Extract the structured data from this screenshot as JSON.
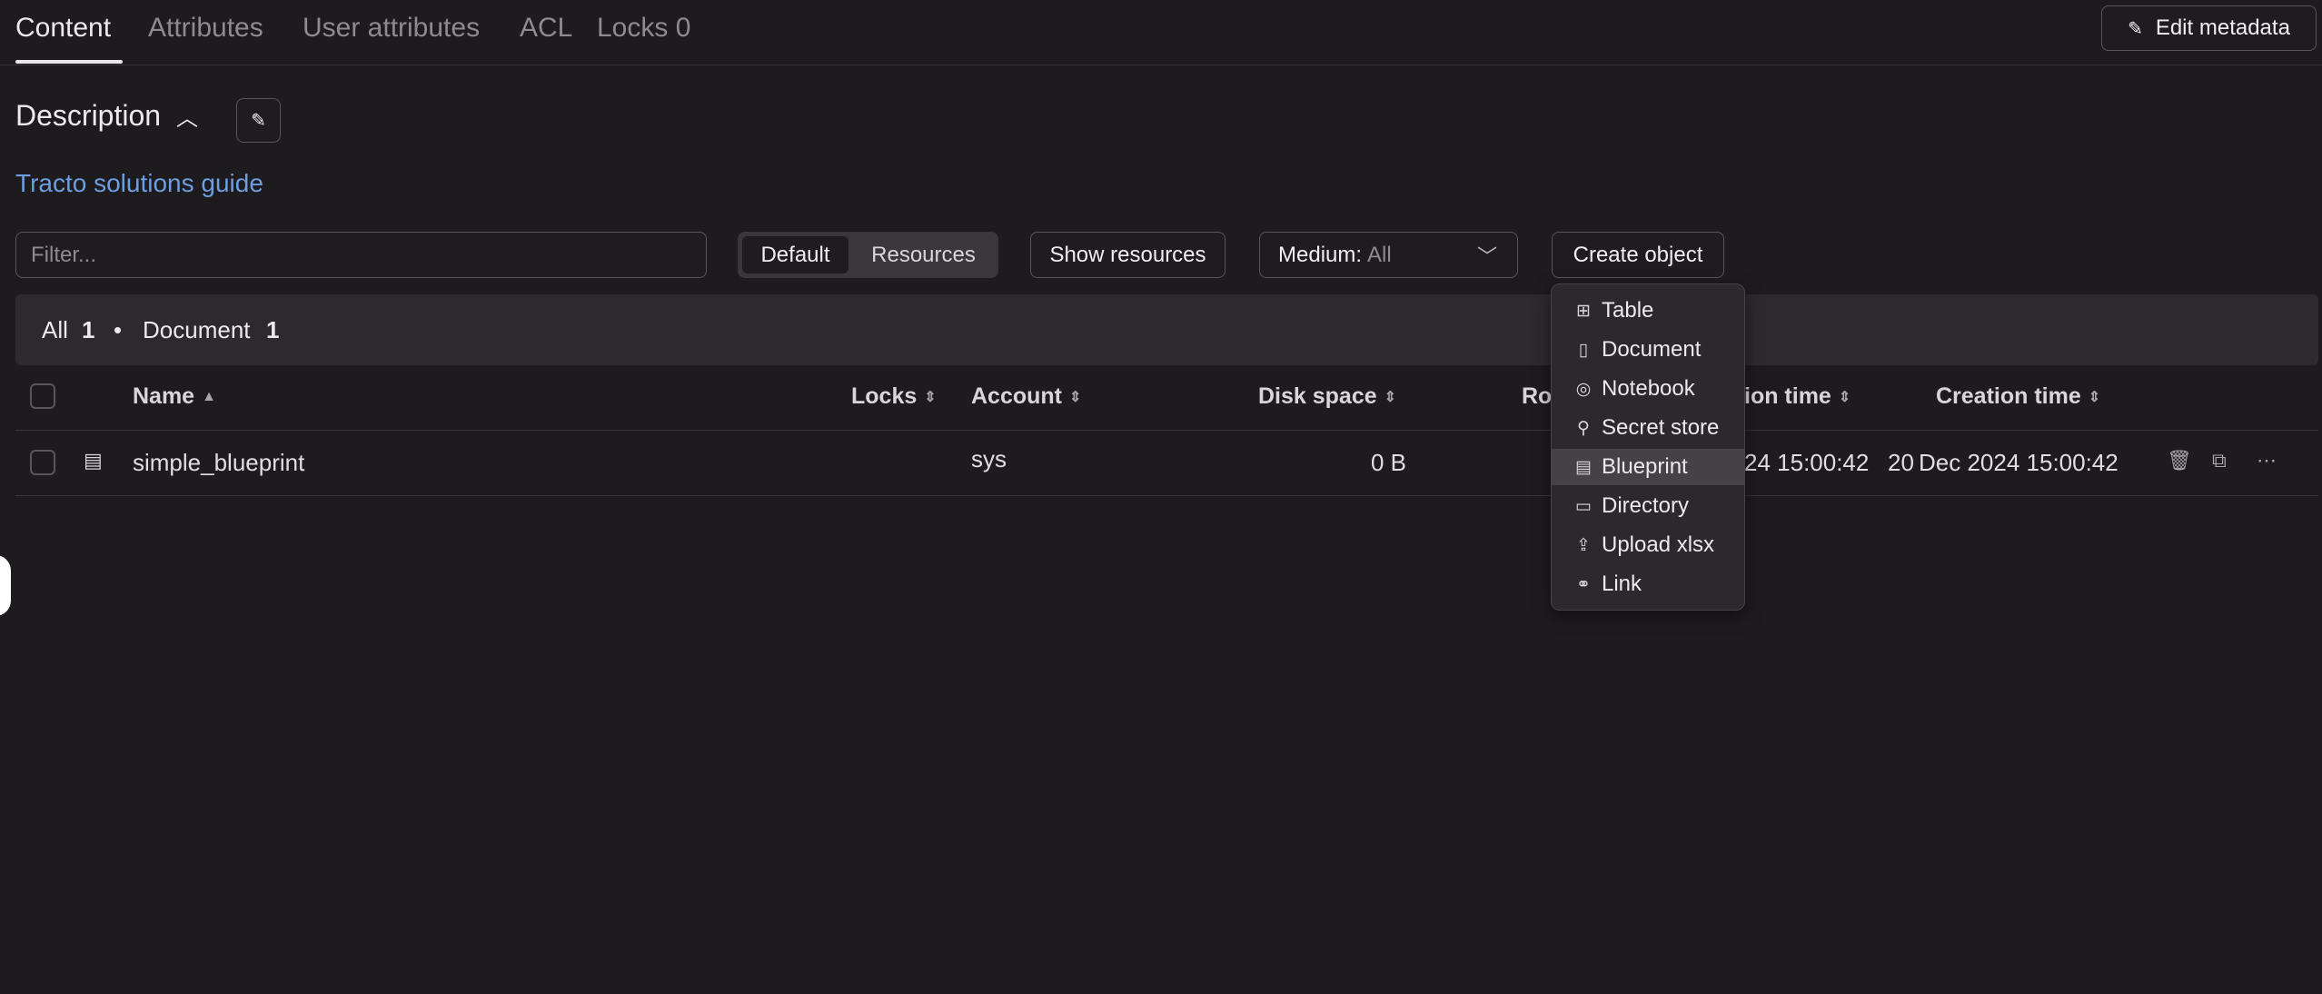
{
  "tabs": [
    {
      "label": "Content"
    },
    {
      "label": "Attributes"
    },
    {
      "label": "User attributes"
    },
    {
      "label": "ACL"
    },
    {
      "label": "Locks"
    }
  ],
  "locks_count": "0",
  "edit_metadata_label": "Edit metadata",
  "description": {
    "title": "Description",
    "link_text": "Tracto solutions guide"
  },
  "toolbar": {
    "filter_placeholder": "Filter...",
    "mode_default": "Default",
    "mode_resources": "Resources",
    "show_resources": "Show resources",
    "medium_label": "Medium:",
    "medium_value": "All",
    "create_object": "Create object"
  },
  "summary": {
    "all_label": "All",
    "all_count": "1",
    "doc_label": "Document",
    "doc_count": "1"
  },
  "table": {
    "headers": {
      "name": "Name",
      "locks": "Locks",
      "account": "Account",
      "disk_space": "Disk space",
      "ro": "Ro",
      "mod_time": "ion time",
      "creation_time": "Creation time"
    },
    "rows": [
      {
        "name": "simple_blueprint",
        "account": "sys",
        "disk_space": "0 B",
        "mod_time": "24 15:00:42",
        "creation_prefix": "20",
        "creation_time": "Dec 2024 15:00:42"
      }
    ]
  },
  "create_menu": [
    {
      "label": "Table",
      "icon": "table-icon"
    },
    {
      "label": "Document",
      "icon": "document-icon"
    },
    {
      "label": "Notebook",
      "icon": "notebook-icon"
    },
    {
      "label": "Secret store",
      "icon": "secret-store-icon"
    },
    {
      "label": "Blueprint",
      "icon": "blueprint-icon"
    },
    {
      "label": "Directory",
      "icon": "directory-icon"
    },
    {
      "label": "Upload xlsx",
      "icon": "upload-icon"
    },
    {
      "label": "Link",
      "icon": "link-icon"
    }
  ],
  "colors": {
    "background": "#1e1b1f",
    "link": "#6c9ee0",
    "menu_highlight": "#454147"
  }
}
